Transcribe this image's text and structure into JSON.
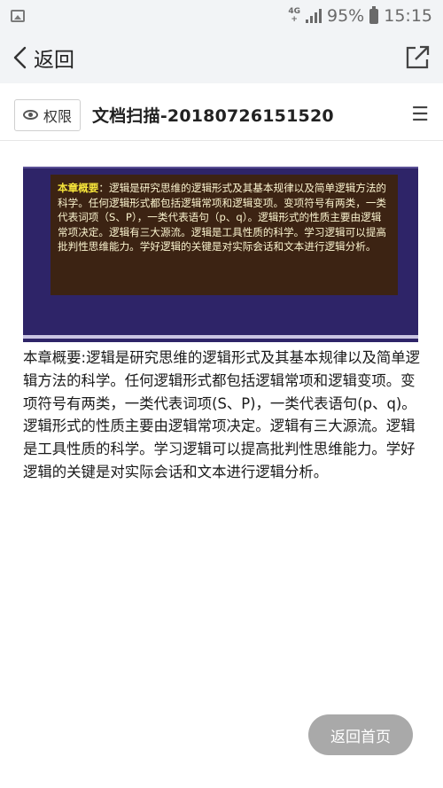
{
  "status_bar": {
    "network_top": "4G",
    "network_bottom": "+",
    "battery_percent": "95%",
    "time": "15:15"
  },
  "nav": {
    "back_label": "返回"
  },
  "doc": {
    "permission_label": "权限",
    "title": "文档扫描-20180726151520"
  },
  "scan_image": {
    "heading": "本章概要",
    "body": "：逻辑是研究思维的逻辑形式及其基本规律以及简单逻辑方法的科学。任何逻辑形式都包括逻辑常项和逻辑变项。变项符号有两类，一类代表词项（S、P），一类代表语句（p、q）。逻辑形式的性质主要由逻辑常项决定。逻辑有三大源流。逻辑是工具性质的科学。学习逻辑可以提高批判性思维能力。学好逻辑的关键是对实际会话和文本进行逻辑分析。"
  },
  "ocr_text": "本章概要:逻辑是研究思维的逻辑形式及其基本规律以及简单逻辑方法的科学。任何逻辑形式都包括逻辑常项和逻辑变项。变项符号有两类，一类代表词项(S、P)，一类代表语句(p、q)。逻辑形式的性质主要由逻辑常项决定。逻辑有三大源流。逻辑是工具性质的科学。学习逻辑可以提高批判性思维能力。学好逻辑的关键是对实际会话和文本进行逻辑分析。",
  "home_button": "返回首页"
}
